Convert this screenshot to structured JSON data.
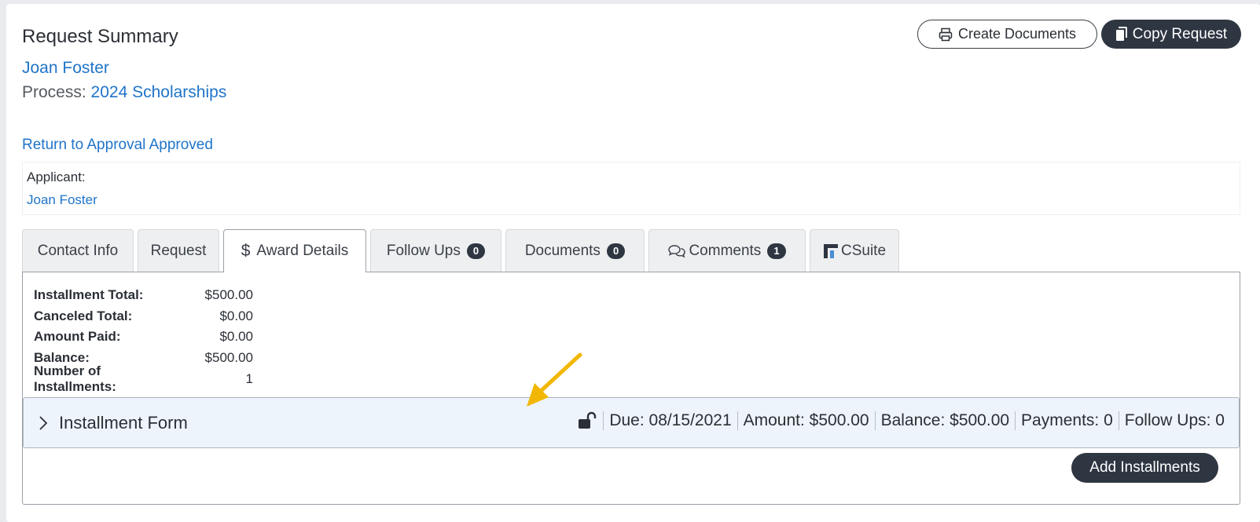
{
  "header": {
    "title": "Request Summary",
    "applicant_link": "Joan Foster",
    "process_label": "Process:",
    "process_link": "2024 Scholarships",
    "return_link": "Return to Approval Approved"
  },
  "actions": {
    "create_documents": "Create Documents",
    "copy_request": "Copy Request"
  },
  "applicant": {
    "label": "Applicant:",
    "name": "Joan Foster"
  },
  "tabs": [
    {
      "label": "Contact Info"
    },
    {
      "label": "Request"
    },
    {
      "label": "Award Details",
      "icon": "$"
    },
    {
      "label": "Follow Ups",
      "badge": "0"
    },
    {
      "label": "Documents",
      "badge": "0"
    },
    {
      "label": "Comments",
      "badge": "1"
    },
    {
      "label": "CSuite"
    }
  ],
  "summary": [
    {
      "label": "Installment Total:",
      "value": "$500.00"
    },
    {
      "label": "Canceled Total:",
      "value": "$0.00"
    },
    {
      "label": "Amount Paid:",
      "value": "$0.00"
    },
    {
      "label": "Balance:",
      "value": "$500.00"
    },
    {
      "label": "Number of Installments:",
      "value": "1"
    }
  ],
  "installment": {
    "title": "Installment Form",
    "due": "Due: 08/15/2021",
    "amount": "Amount: $500.00",
    "balance": "Balance: $500.00",
    "payments": "Payments: 0",
    "follow_ups": "Follow Ups: 0"
  },
  "add_installments": "Add Installments",
  "colors": {
    "link": "#1f74c9",
    "dark_button": "#2e3642",
    "annotation_arrow": "#f2b705"
  }
}
